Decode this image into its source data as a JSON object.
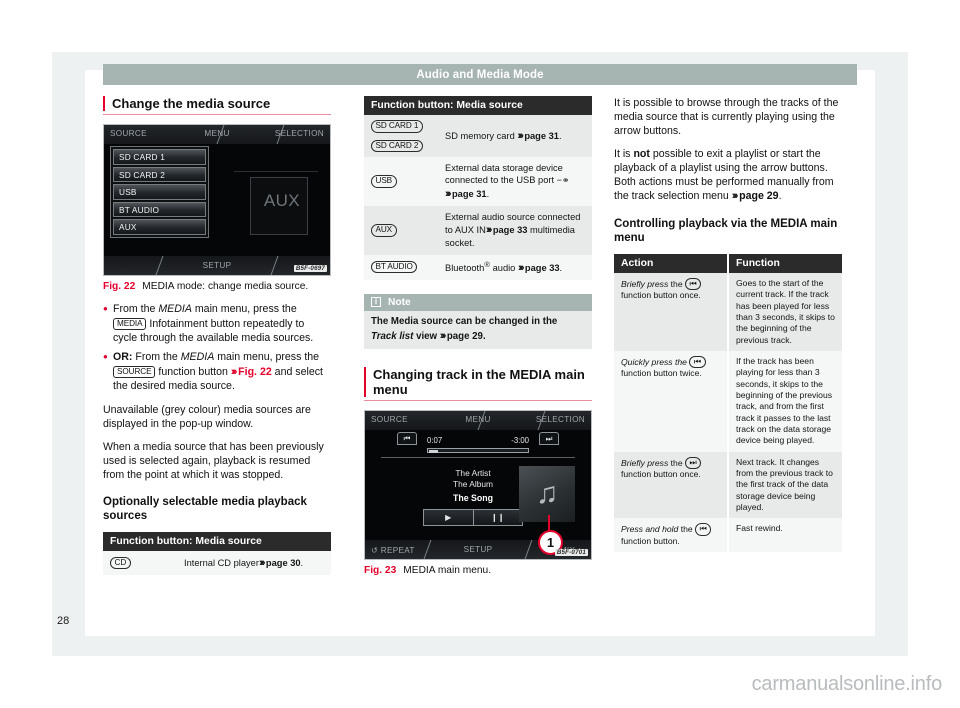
{
  "header": {
    "chapter_title": "Audio and Media Mode"
  },
  "page_number": "28",
  "watermark": "carmanualsonline.info",
  "col1": {
    "section_title": "Change the media source",
    "figure": {
      "screen_code": "B5F-0697",
      "top_labels": {
        "source": "SOURCE",
        "menu": "MENU",
        "selection": "SELECTION"
      },
      "bottom_labels": {
        "setup": "SETUP"
      },
      "aux_label": "AUX",
      "source_items": [
        "SD CARD 1",
        "SD CARD 2",
        "USB",
        "BT AUDIO",
        "AUX"
      ],
      "caption_num": "Fig. 22",
      "caption_text": "MEDIA mode: change media source."
    },
    "bullet1_pre": "From the ",
    "bullet1_italic": "MEDIA",
    "bullet1_mid": " main menu, press the ",
    "bullet1_key": "MEDIA",
    "bullet1_post": " Infotainment button repeatedly to cycle through the available media sources.",
    "bullet2_or": "OR:",
    "bullet2_pre": " From the ",
    "bullet2_italic": "MEDIA",
    "bullet2_mid": " main menu, press the ",
    "bullet2_key": "SOURCE",
    "bullet2_mid2": " function button ",
    "bullet2_ref": "Fig. 22",
    "bullet2_post": " and select the desired media source.",
    "para1": "Unavailable (grey colour) media sources are displayed in the pop-up window.",
    "para2": "When a media source that has been previously used is selected again, playback is resumed from the point at which it was stopped.",
    "sub_title": "Optionally selectable media playback sources",
    "table": {
      "caption": "Function button: Media source",
      "rows": [
        {
          "key": "CD",
          "text_pre": "Internal CD player",
          "ref": "page 30",
          "text_post": "."
        }
      ]
    }
  },
  "col2": {
    "table": {
      "caption": "Function button: Media source",
      "rows": [
        {
          "keys": [
            "SD CARD 1",
            "SD CARD 2"
          ],
          "text_pre": "SD memory card ",
          "ref": "page 31",
          "text_post": "."
        },
        {
          "keys": [
            "USB"
          ],
          "text_pre": "External data storage device connected to the USB port ",
          "icon": "usb-icon",
          "ref": "page 31",
          "text_post": "."
        },
        {
          "keys": [
            "AUX"
          ],
          "text_pre": "External audio source connected to AUX IN",
          "ref": "page 33",
          "text_post": " multimedia socket."
        },
        {
          "keys": [
            "BT AUDIO"
          ],
          "text_pre": "Bluetooth",
          "sup": "®",
          "text_mid": " audio ",
          "ref": "page 33",
          "text_post": "."
        }
      ]
    },
    "note": {
      "title": "Note",
      "text_pre": "The Media source can be changed in the ",
      "text_italic": "Track list",
      "text_mid": " view ",
      "ref": "page 29",
      "text_post": "."
    },
    "sub_title": "Changing track in the MEDIA main menu",
    "figure": {
      "screen_code": "B5F-0701",
      "top_labels": {
        "source": "SOURCE",
        "menu": "MENU",
        "selection": "SELECTION"
      },
      "bottom_labels": {
        "repeat": "REPEAT",
        "setup": "SETUP",
        "mix": "MIX"
      },
      "elapsed": "0:07",
      "remaining": "-3:00",
      "artist": "The Artist",
      "album": "The Album",
      "song": "The Song",
      "callout": "1",
      "caption_num": "Fig. 23",
      "caption_text": "MEDIA main menu."
    }
  },
  "col3": {
    "para1": "It is possible to browse through the tracks of the media source that is currently playing using the arrow buttons.",
    "para2_pre": "It is ",
    "para2_bold": "not",
    "para2_mid": " possible to exit a playlist or start the playback of a playlist using the arrow buttons. Both actions must be performed manually from the track selection menu ",
    "para2_ref": "page 29",
    "para2_post": ".",
    "sub_title": "Controlling playback via the MEDIA main menu",
    "table": {
      "headers": [
        "Action",
        "Function"
      ],
      "rows": [
        {
          "action_italic": "Briefly press",
          "action_mid": " the ",
          "action_key": "prev-icon",
          "action_post": " function button once.",
          "function": "Goes to the start of the current track. If the track has been played for less than 3 seconds, it skips to the beginning of the previous track."
        },
        {
          "action_italic": "Quickly press the",
          "action_mid": " ",
          "action_key": "prev-icon",
          "action_post": " function button twice.",
          "function": "If the track has been playing for less than 3 seconds, it skips to the beginning of the previous track, and from the first track it passes to the last track on the data storage device being played."
        },
        {
          "action_italic": "Briefly press",
          "action_mid": " the ",
          "action_key": "next-icon",
          "action_post": " function button once.",
          "function": "Next track. It changes from the previous track to the first track of the data storage device being played."
        },
        {
          "action_italic": "Press and hold",
          "action_mid": " the ",
          "action_key": "prev-icon",
          "action_post": " function button.",
          "function": "Fast rewind."
        }
      ]
    }
  }
}
